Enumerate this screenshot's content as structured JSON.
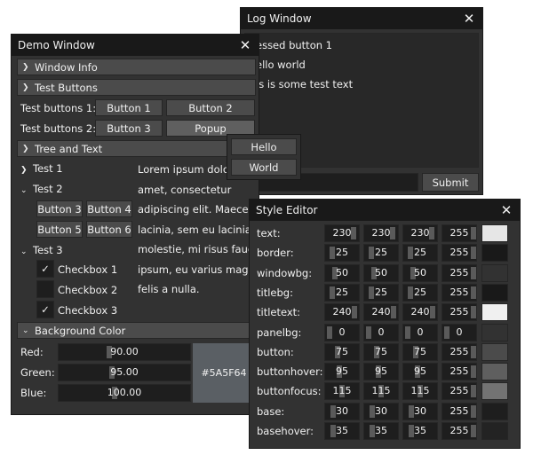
{
  "log_window": {
    "title": "Log Window",
    "lines": [
      "essed button 1",
      "ello world",
      "is is some test text"
    ],
    "submit_label": "Submit"
  },
  "demo_window": {
    "title": "Demo Window",
    "sections": {
      "window_info": "Window Info",
      "test_buttons": "Test Buttons",
      "tree_and_text": "Tree and Text",
      "background_color": "Background Color"
    },
    "test_buttons_1_label": "Test buttons 1:",
    "test_buttons_2_label": "Test buttons 2:",
    "buttons": {
      "b1": "Button 1",
      "b2": "Button 2",
      "b3": "Button 3",
      "popup": "Popup"
    },
    "popup_items": [
      "Hello",
      "World"
    ],
    "tree": {
      "test1": "Test 1",
      "test2": "Test 2",
      "test2_buttons": [
        "Button 3",
        "Button 4",
        "Button 5",
        "Button 6"
      ],
      "test3": "Test 3",
      "checkboxes": [
        {
          "label": "Checkbox 1",
          "checked": true
        },
        {
          "label": "Checkbox 2",
          "checked": false
        },
        {
          "label": "Checkbox 3",
          "checked": true
        }
      ]
    },
    "lorem_lines": [
      "Lorem ipsum dolor s",
      "amet, consectetur",
      "adipiscing elit. Maecenas",
      "lacinia, sem eu lacinia",
      "molestie, mi risus faucibu",
      "ipsum, eu varius magna",
      "felis a nulla."
    ],
    "bg_color": {
      "red_label": "Red:",
      "red_value": "90.00",
      "green_label": "Green:",
      "green_value": "95.00",
      "blue_label": "Blue:",
      "blue_value": "100.00",
      "hex": "#5A5F64",
      "hex_color": "#5A5F64"
    }
  },
  "style_editor": {
    "title": "Style Editor",
    "rows": [
      {
        "name": "text:",
        "vals": [
          "230",
          "230",
          "230",
          "255"
        ],
        "swatch": "#e6e6e6"
      },
      {
        "name": "border:",
        "vals": [
          "25",
          "25",
          "25",
          "255"
        ],
        "swatch": "#191919"
      },
      {
        "name": "windowbg:",
        "vals": [
          "50",
          "50",
          "50",
          "255"
        ],
        "swatch": "#323232"
      },
      {
        "name": "titlebg:",
        "vals": [
          "25",
          "25",
          "25",
          "255"
        ],
        "swatch": "#191919"
      },
      {
        "name": "titletext:",
        "vals": [
          "240",
          "240",
          "240",
          "255"
        ],
        "swatch": "#f0f0f0"
      },
      {
        "name": "panelbg:",
        "vals": [
          "0",
          "0",
          "0",
          "0"
        ],
        "swatch": "#323232"
      },
      {
        "name": "button:",
        "vals": [
          "75",
          "75",
          "75",
          "255"
        ],
        "swatch": "#4b4b4b"
      },
      {
        "name": "buttonhover:",
        "vals": [
          "95",
          "95",
          "95",
          "255"
        ],
        "swatch": "#5f5f5f"
      },
      {
        "name": "buttonfocus:",
        "vals": [
          "115",
          "115",
          "115",
          "255"
        ],
        "swatch": "#737373"
      },
      {
        "name": "base:",
        "vals": [
          "30",
          "30",
          "30",
          "255"
        ],
        "swatch": "#1e1e1e"
      },
      {
        "name": "basehover:",
        "vals": [
          "35",
          "35",
          "35",
          "255"
        ],
        "swatch": "#232323"
      }
    ]
  }
}
